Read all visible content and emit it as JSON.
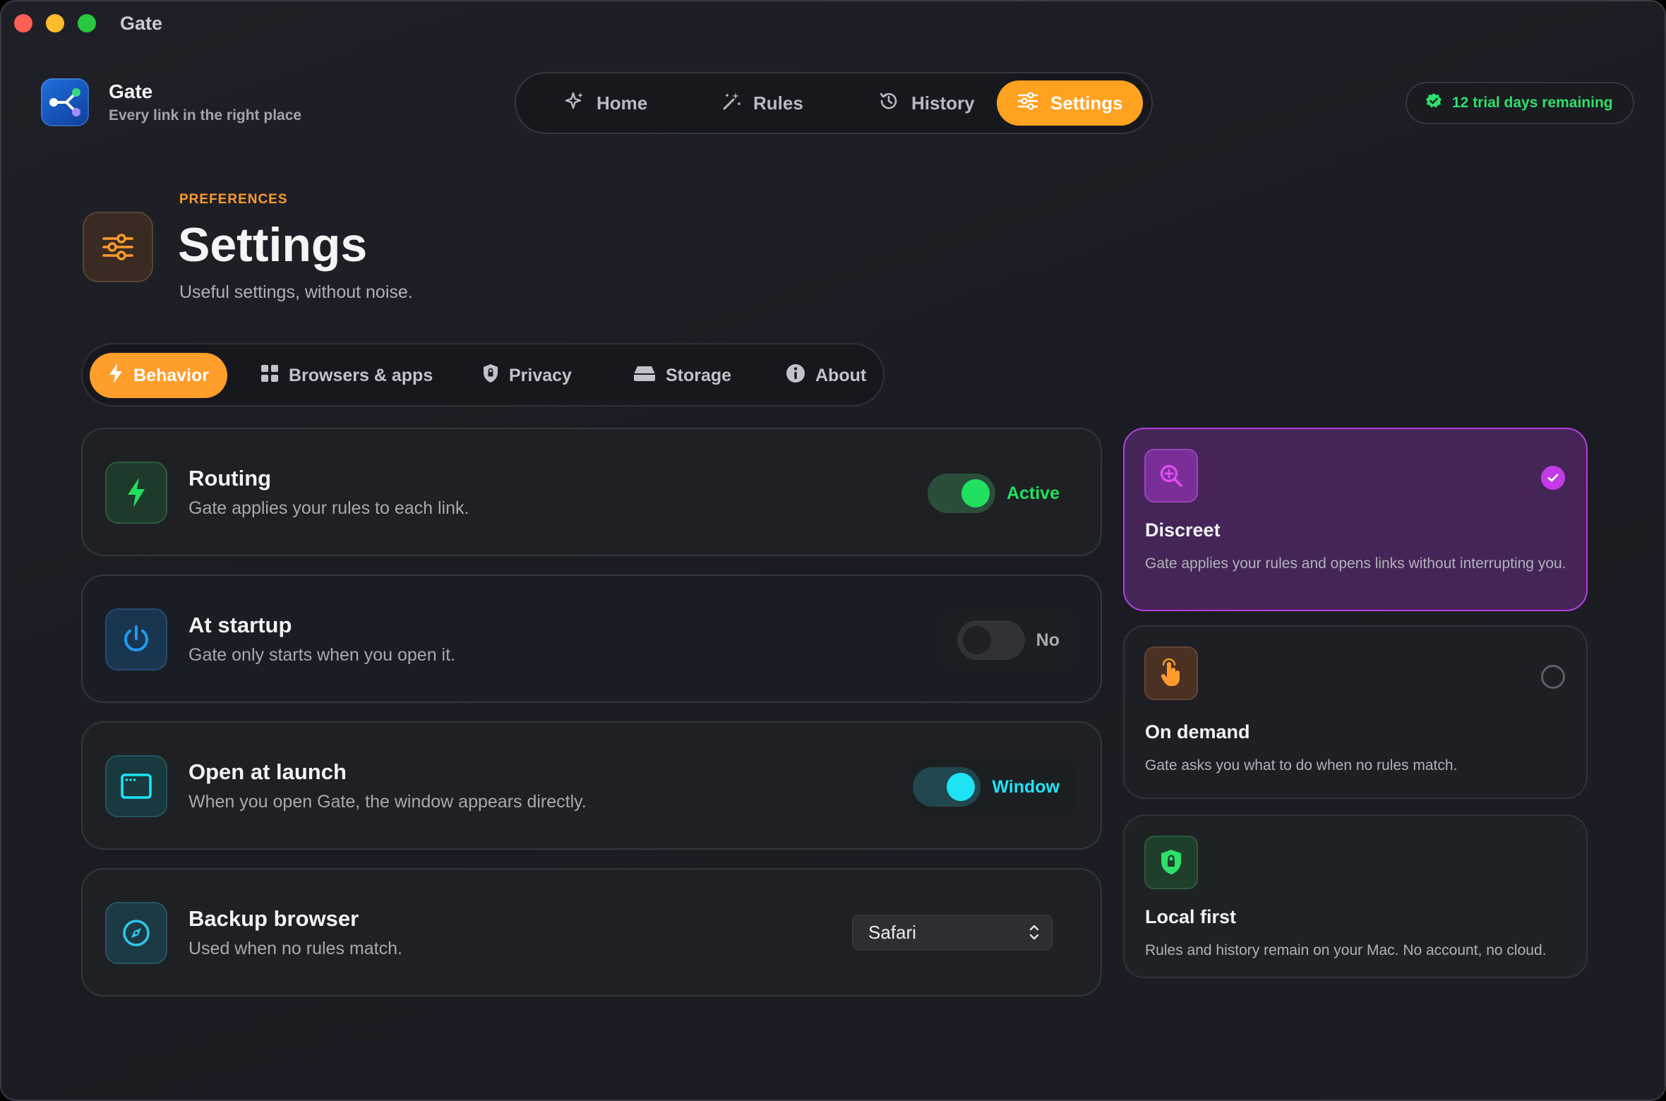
{
  "window": {
    "title": "Gate"
  },
  "brand": {
    "name": "Gate",
    "tagline": "Every link in the right place"
  },
  "nav": {
    "items": [
      {
        "label": "Home",
        "icon": "sparkle-icon",
        "active": false
      },
      {
        "label": "Rules",
        "icon": "magic-wand-icon",
        "active": false
      },
      {
        "label": "History",
        "icon": "history-clock-icon",
        "active": false
      },
      {
        "label": "Settings",
        "icon": "sliders-icon",
        "active": true
      }
    ]
  },
  "trial": {
    "label": "12 trial days remaining",
    "color": "#2ee06a"
  },
  "page": {
    "eyebrow": "PREFERENCES",
    "title": "Settings",
    "subtitle": "Useful settings, without noise."
  },
  "tabs": [
    {
      "label": "Behavior",
      "icon": "bolt-icon",
      "active": true
    },
    {
      "label": "Browsers & apps",
      "icon": "grid-icon",
      "active": false
    },
    {
      "label": "Privacy",
      "icon": "shield-icon",
      "active": false
    },
    {
      "label": "Storage",
      "icon": "drive-icon",
      "active": false
    },
    {
      "label": "About",
      "icon": "info-icon",
      "active": false
    }
  ],
  "settings": {
    "routing": {
      "title": "Routing",
      "description": "Gate applies your rules to each link.",
      "state": "Active",
      "on": true,
      "accent": "#22e05f"
    },
    "startup": {
      "title": "At startup",
      "description": "Gate only starts when you open it.",
      "state": "No",
      "on": false,
      "accent": "#1e9bf0"
    },
    "launch": {
      "title": "Open at launch",
      "description": "When you open Gate, the window appears directly.",
      "state": "Window",
      "on": true,
      "accent": "#1ee3f5"
    },
    "backup": {
      "title": "Backup browser",
      "description": "Used when no rules match.",
      "value": "Safari",
      "accent": "#2fc6e8"
    }
  },
  "modes": {
    "discreet": {
      "title": "Discreet",
      "description": "Gate applies your rules and opens links without interrupting you.",
      "selected": true,
      "accent": "#d93ff0"
    },
    "on_demand": {
      "title": "On demand",
      "description": "Gate asks you what to do when no rules match.",
      "selected": false,
      "accent": "#ff9b2d"
    },
    "local_first": {
      "title": "Local first",
      "description": "Rules and history remain on your Mac. No account, no cloud.",
      "accent": "#2ee06a"
    }
  }
}
